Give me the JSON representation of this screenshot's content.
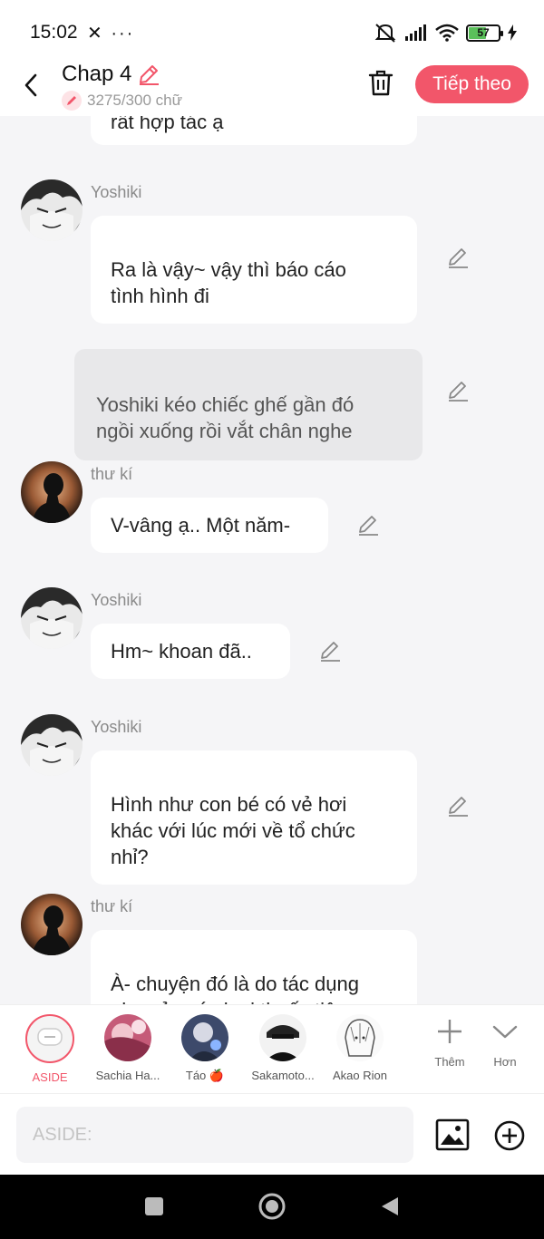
{
  "status_bar": {
    "time": "15:02",
    "left_icons": "✕ ···",
    "battery": "57"
  },
  "header": {
    "title": "Chap 4",
    "word_count": "3275/300 chữ",
    "next_button": "Tiếp theo"
  },
  "chat": {
    "top_fragment": "rất hợp tác ạ",
    "messages": [
      {
        "type": "character",
        "speaker": "Yoshiki",
        "text": "Ra là vậy~ vậy thì báo cáo\ntình hình đi",
        "avatar": "yoshiki"
      },
      {
        "type": "aside",
        "text": "Yoshiki kéo chiếc ghế gần đó\nngồi xuống rồi vắt chân nghe"
      },
      {
        "type": "character",
        "speaker": "thư kí",
        "text": "V-vâng ạ.. Một năm-",
        "avatar": "silhouette"
      },
      {
        "type": "character",
        "speaker": "Yoshiki",
        "text": "Hm~ khoan đã..",
        "avatar": "yoshiki"
      },
      {
        "type": "character",
        "speaker": "Yoshiki",
        "text": "Hình như con bé có vẻ hơi\nkhác với lúc mới về tổ chức\nnhỉ?",
        "avatar": "yoshiki"
      },
      {
        "type": "character",
        "speaker": "thư kí",
        "text": "À- chuyện đó là do tác dụng\nphụ của các loại thuốc tiêm",
        "avatar": "silhouette"
      }
    ]
  },
  "characters": [
    {
      "label": "ASIDE",
      "selected": true
    },
    {
      "label": "Sachia Ha...",
      "selected": false
    },
    {
      "label": "Táo 🍎",
      "selected": false
    },
    {
      "label": "Sakamoto...",
      "selected": false
    },
    {
      "label": "Akao Rion",
      "selected": false
    }
  ],
  "tools": {
    "add_label": "Thêm",
    "more_label": "Hơn"
  },
  "input": {
    "placeholder": "ASIDE:"
  },
  "colors": {
    "accent": "#f2566a",
    "background": "#f5f5f7",
    "bubble": "#ffffff",
    "aside_bubble": "#e8e8ea"
  }
}
